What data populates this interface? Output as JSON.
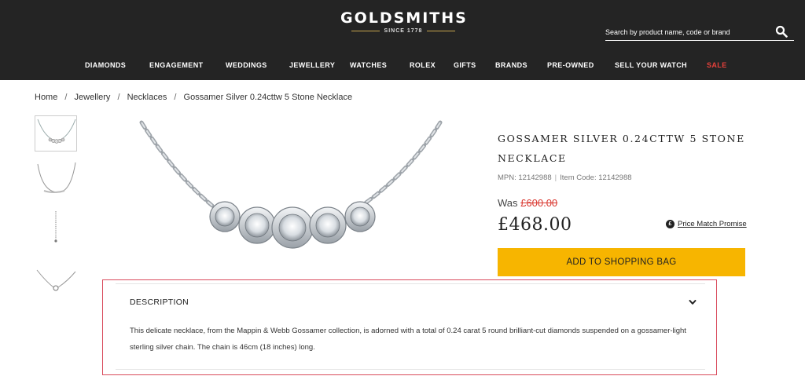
{
  "brand": {
    "name": "GOLDSMITHS",
    "since": "SINCE 1778"
  },
  "search": {
    "placeholder": "Search by product name, code or brand"
  },
  "nav": {
    "items": [
      {
        "label": "DIAMONDS"
      },
      {
        "label": "ENGAGEMENT"
      },
      {
        "label": "WEDDINGS"
      },
      {
        "label": "JEWELLERY"
      },
      {
        "label": "WATCHES"
      },
      {
        "label": "ROLEX"
      },
      {
        "label": "GIFTS"
      },
      {
        "label": "BRANDS"
      },
      {
        "label": "PRE-OWNED"
      },
      {
        "label": "SELL YOUR WATCH"
      },
      {
        "label": "SALE"
      }
    ]
  },
  "breadcrumb": {
    "items": [
      "Home",
      "Jewellery",
      "Necklaces",
      "Gossamer Silver 0.24cttw 5 Stone Necklace"
    ],
    "separator": "/"
  },
  "product": {
    "title": "GOSSAMER SILVER 0.24CTTW 5 STONE NECKLACE",
    "mpn": "MPN: 12142988",
    "item_code": "Item Code: 12142988",
    "was_label": "Was",
    "was_price": "£600.00",
    "price": "£468.00",
    "price_match": "Price Match Promise",
    "add_to_bag": "ADD TO SHOPPING BAG"
  },
  "description": {
    "heading": "DESCRIPTION",
    "text": "This delicate necklace, from the Mappin & Webb Gossamer collection, is adorned with a total of 0.24 carat 5 round brilliant-cut diamonds suspended on a gossamer-light sterling silver chain. The chain is 46cm (18 inches) long."
  },
  "colors": {
    "header_bg": "#242424",
    "accent_gold": "#c9a64d",
    "button_yellow": "#f7b500",
    "sale_red": "#e8413b",
    "was_red": "#d9372f"
  }
}
